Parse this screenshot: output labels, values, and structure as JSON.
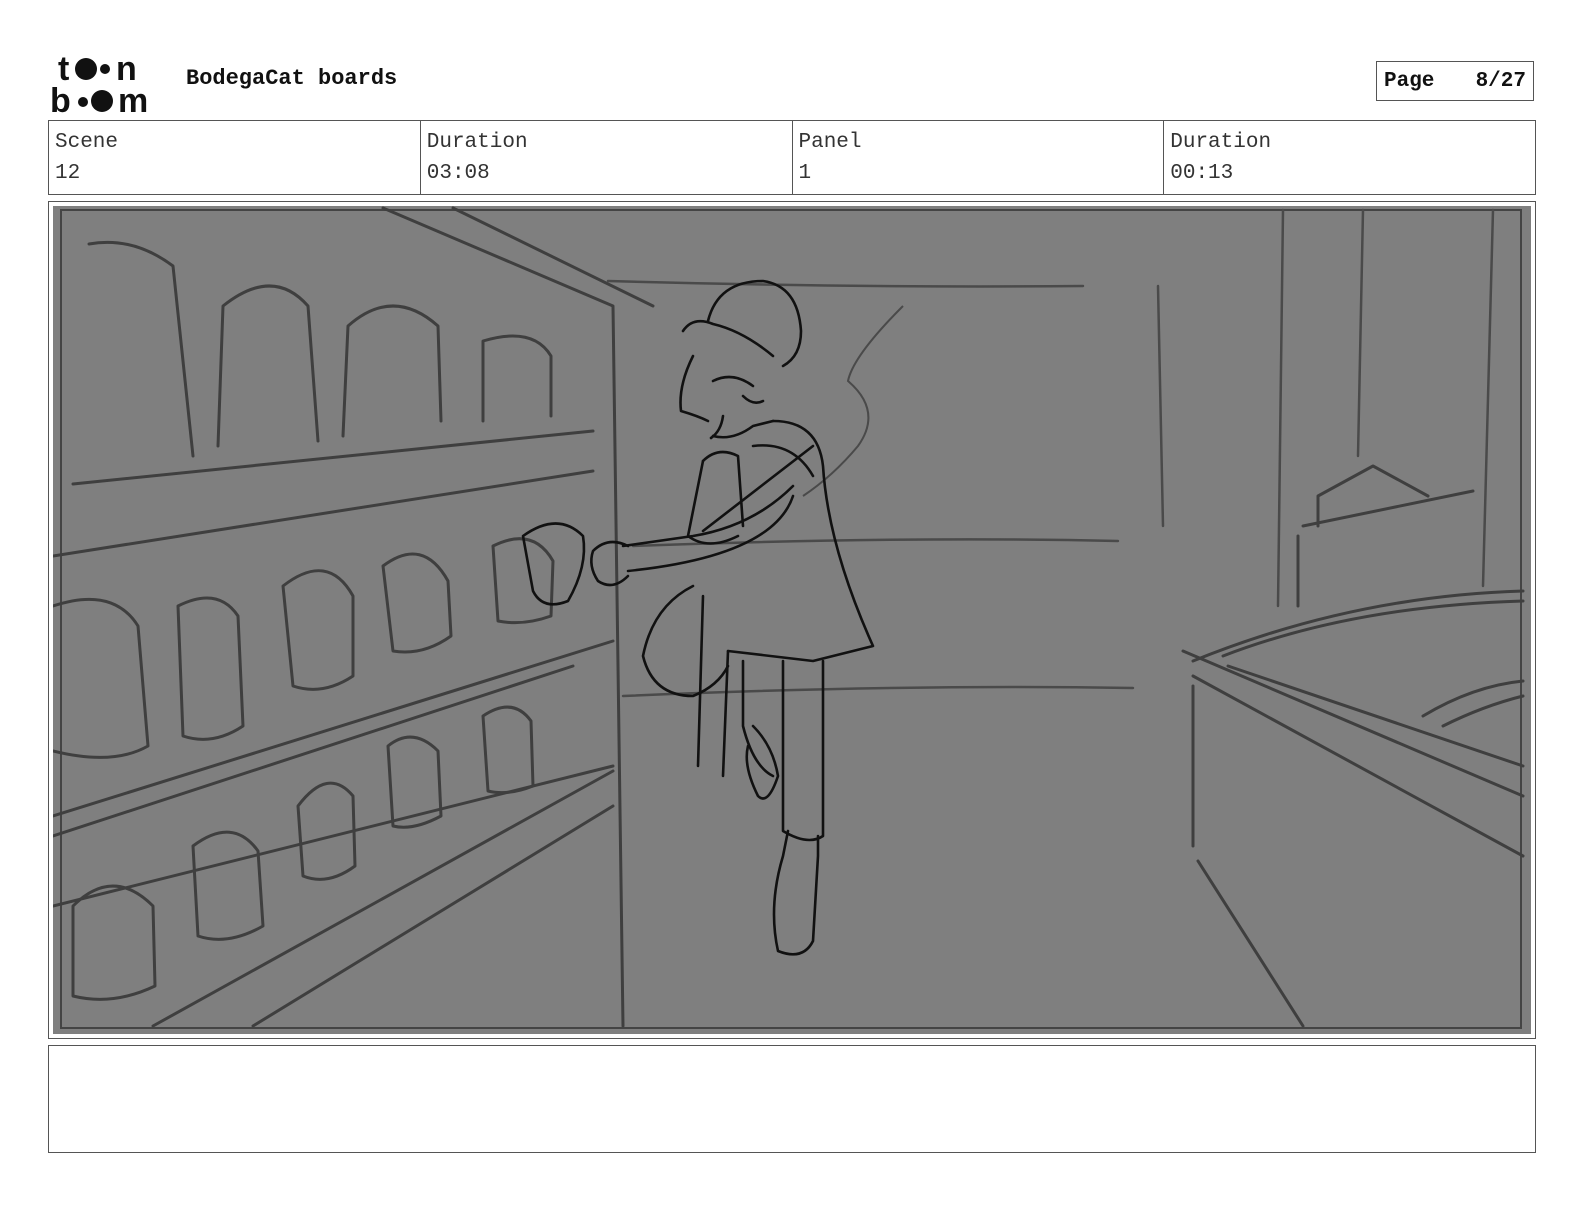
{
  "header": {
    "logo_text": "toon boom",
    "title": "BodegaCat boards",
    "page_label": "Page",
    "page_value": "8/27"
  },
  "info": [
    {
      "label": "Scene",
      "value": "12"
    },
    {
      "label": "Duration",
      "value": "03:08"
    },
    {
      "label": "Panel",
      "value": "1"
    },
    {
      "label": "Duration",
      "value": "00:13"
    }
  ],
  "panel": {
    "description": "",
    "background_color": "#7f7f7f"
  },
  "notes": {
    "text": ""
  }
}
